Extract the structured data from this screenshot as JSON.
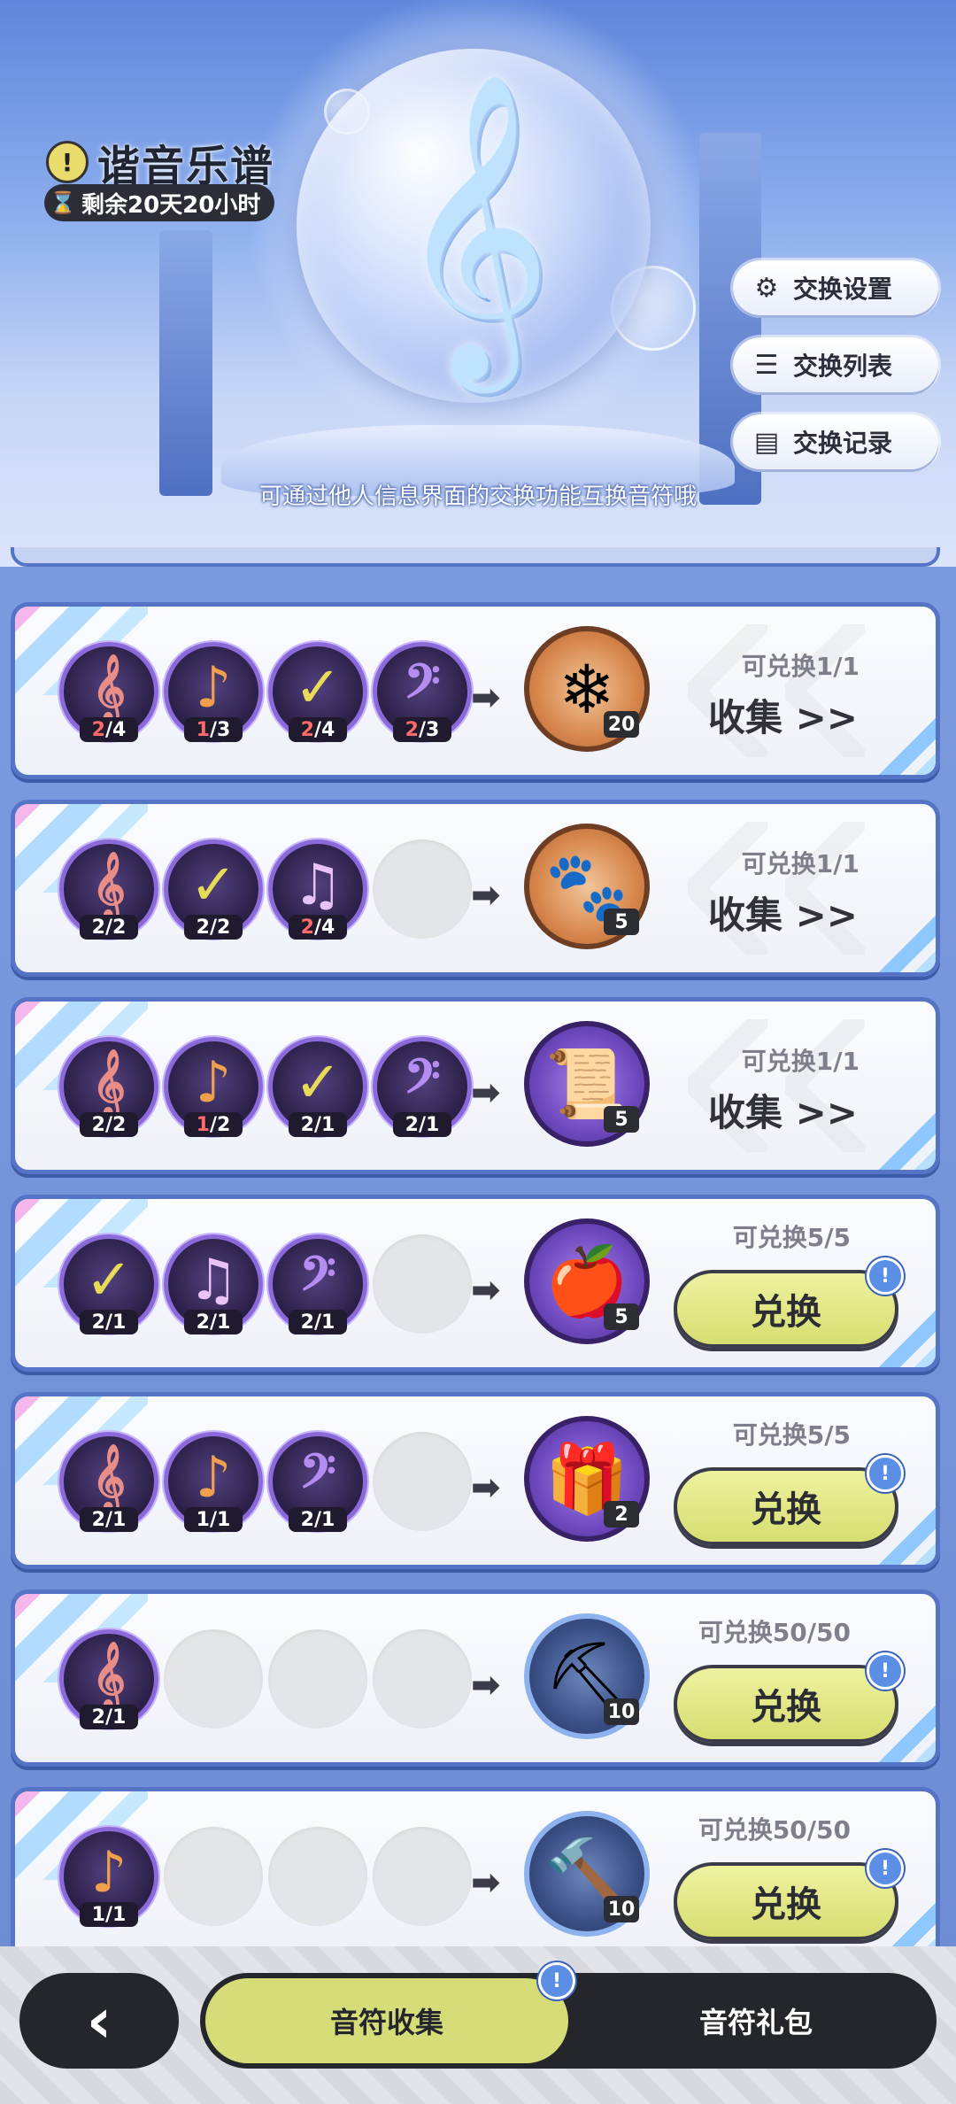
{
  "header": {
    "title": "谐音乐谱",
    "timer": "剩余20天20小时",
    "hint": "可通过他人信息界面的交换功能互换音符哦",
    "buttons": [
      {
        "label": "交换设置",
        "icon": "gear-icon"
      },
      {
        "label": "交换列表",
        "icon": "list-icon"
      },
      {
        "label": "交换记录",
        "icon": "document-icon"
      }
    ]
  },
  "rows": [
    {
      "notes": [
        {
          "type": "treble-clef",
          "have": "2",
          "need": "/4",
          "short": true
        },
        {
          "type": "eighth-note",
          "have": "1",
          "need": "/3",
          "short": true
        },
        {
          "type": "check-note",
          "have": "2",
          "need": "/4",
          "short": true
        },
        {
          "type": "bass-clef",
          "have": "2",
          "need": "/3",
          "short": true
        }
      ],
      "reward": {
        "icon": "crystal-icon",
        "count": "20"
      },
      "availability": "可兑换1/1",
      "action": "收集 >>",
      "action_type": "collect"
    },
    {
      "notes": [
        {
          "type": "treble-clef",
          "have": "2",
          "need": "/2",
          "short": false
        },
        {
          "type": "check-note",
          "have": "2",
          "need": "/2",
          "short": false
        },
        {
          "type": "beamed-note",
          "have": "2",
          "need": "/4",
          "short": true
        }
      ],
      "reward": {
        "icon": "paw-charm-icon",
        "count": "5"
      },
      "availability": "可兑换1/1",
      "action": "收集 >>",
      "action_type": "collect"
    },
    {
      "notes": [
        {
          "type": "treble-clef",
          "have": "2",
          "need": "/2",
          "short": false
        },
        {
          "type": "eighth-note",
          "have": "1",
          "need": "/2",
          "short": true
        },
        {
          "type": "check-note",
          "have": "2",
          "need": "/1",
          "short": false
        },
        {
          "type": "bass-clef",
          "have": "2",
          "need": "/1",
          "short": false
        }
      ],
      "reward": {
        "icon": "scroll-icon",
        "count": "5"
      },
      "availability": "可兑换1/1",
      "action": "收集 >>",
      "action_type": "collect"
    },
    {
      "notes": [
        {
          "type": "check-note",
          "have": "2",
          "need": "/1",
          "short": false
        },
        {
          "type": "beamed-note",
          "have": "2",
          "need": "/1",
          "short": false
        },
        {
          "type": "bass-clef",
          "have": "2",
          "need": "/1",
          "short": false
        }
      ],
      "reward": {
        "icon": "apple-icon",
        "count": "5"
      },
      "availability": "可兑换5/5",
      "action": "兑换",
      "action_type": "exchange"
    },
    {
      "notes": [
        {
          "type": "treble-clef",
          "have": "2",
          "need": "/1",
          "short": false
        },
        {
          "type": "eighth-note",
          "have": "1",
          "need": "/1",
          "short": false
        },
        {
          "type": "bass-clef",
          "have": "2",
          "need": "/1",
          "short": false
        }
      ],
      "reward": {
        "icon": "mystery-gift-icon",
        "count": "2"
      },
      "availability": "可兑换5/5",
      "action": "兑换",
      "action_type": "exchange"
    },
    {
      "notes": [
        {
          "type": "treble-clef",
          "have": "2",
          "need": "/1",
          "short": false
        }
      ],
      "reward": {
        "icon": "pickaxe-icon",
        "count": "10"
      },
      "availability": "可兑换50/50",
      "action": "兑换",
      "action_type": "exchange"
    },
    {
      "notes": [
        {
          "type": "eighth-note",
          "have": "1",
          "need": "/1",
          "short": false
        }
      ],
      "reward": {
        "icon": "hammer-icon",
        "count": "10"
      },
      "availability": "可兑换50/50",
      "action": "兑换",
      "action_type": "exchange"
    }
  ],
  "bottom": {
    "back_icon": "back-arrow-icon",
    "tab_active": "音符收集",
    "tab_other": "音符礼包"
  },
  "colors": {
    "frame_blue": "#5574c6",
    "exchange_button": "#d7de70",
    "badge_blue": "#5b8fe6",
    "count_short_red": "#ff6a6a"
  }
}
